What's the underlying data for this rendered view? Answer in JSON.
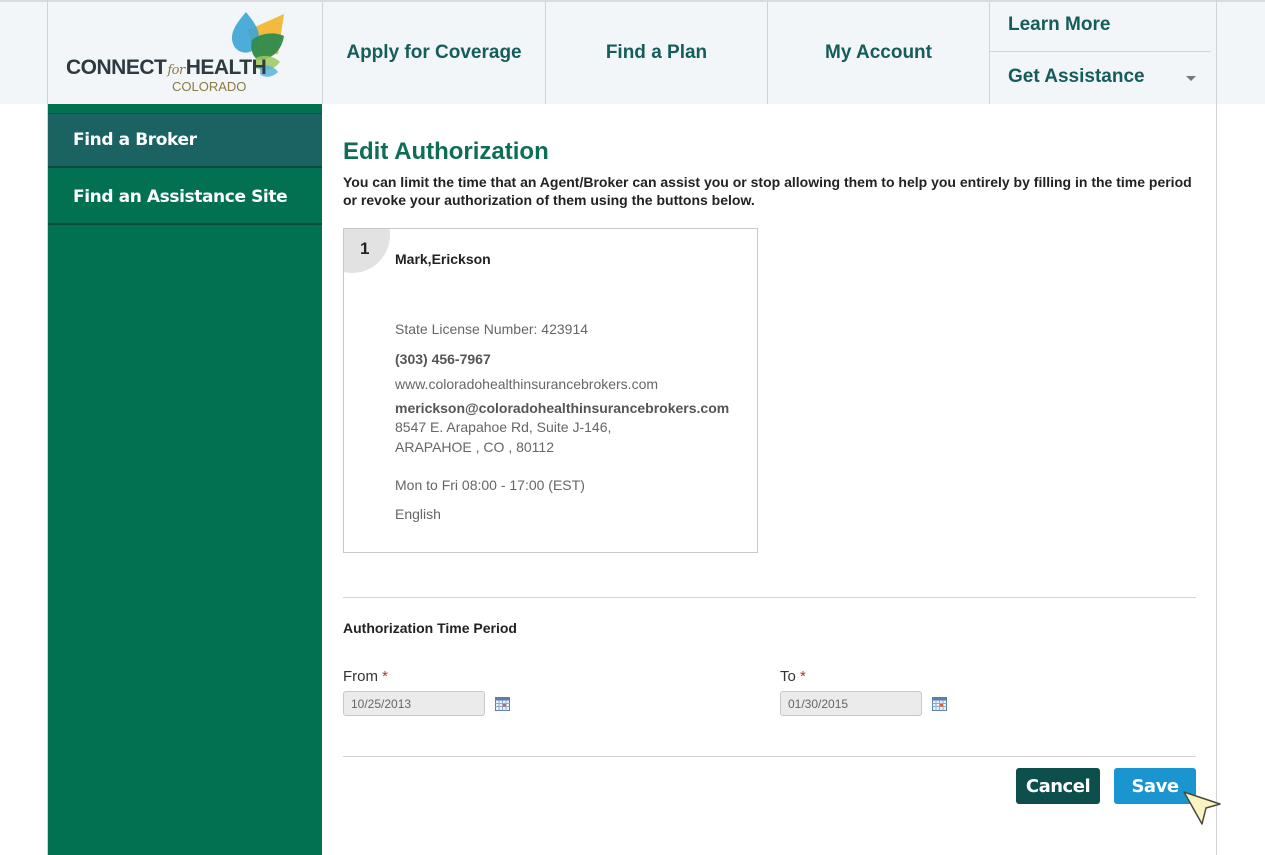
{
  "header": {
    "logo": {
      "connect": "CONNECT",
      "for": "for",
      "health": "HEALTH",
      "colorado": "COLORADO"
    },
    "nav": {
      "apply": "Apply for Coverage",
      "find_plan": "Find a Plan",
      "my_account": "My Account",
      "learn_more": "Learn More",
      "get_assistance": "Get Assistance"
    }
  },
  "sidebar": {
    "items": [
      {
        "label": "Find a Broker",
        "active": true
      },
      {
        "label": "Find an Assistance Site",
        "active": false
      }
    ]
  },
  "main": {
    "title": "Edit Authorization",
    "intro": "You can limit the time that an Agent/Broker can assist you or stop allowing them to help you entirely by filling in the time period or revoke your authorization of them using the buttons below.",
    "broker_card": {
      "number": "1",
      "name": "Mark,Erickson",
      "license": "State License Number: 423914",
      "phone": "(303) 456-7967",
      "website": "www.coloradohealthinsurancebrokers.com",
      "email": "merickson@coloradohealthinsurancebrokers.com",
      "address_line1": "8547 E. Arapahoe Rd, Suite J-146,",
      "address_line2": "ARAPAHOE , CO , 80112",
      "hours": "Mon to Fri 08:00 - 17:00 (EST)",
      "language": "English"
    },
    "time_period": {
      "title": "Authorization Time Period",
      "from_label": "From",
      "from_value": "10/25/2013",
      "to_label": "To",
      "to_value": "01/30/2015",
      "required_mark": "*"
    },
    "buttons": {
      "cancel": "Cancel",
      "save": "Save"
    }
  },
  "colors": {
    "brand_green": "#027152",
    "nav_text": "#155d5b",
    "active_sidebar": "#1b6262",
    "cancel_button": "#0c4f4d",
    "save_button": "#1a95cf"
  }
}
